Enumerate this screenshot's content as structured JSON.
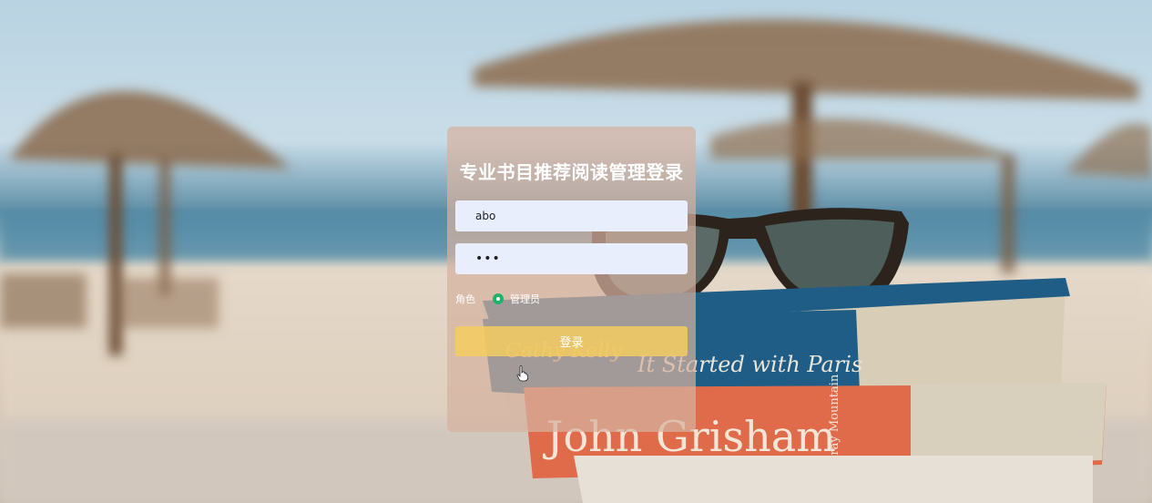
{
  "login": {
    "title": "专业书目推荐阅读管理登录",
    "username_value": "abo",
    "password_value": "•••",
    "role_label": "角色",
    "role_options": [
      {
        "label": "管理员",
        "selected": true
      }
    ],
    "submit_label": "登录"
  },
  "background": {
    "book_titles": [
      "John Grisham",
      "It Started with Paris",
      "Cathy Kelly",
      "Gray Mountain"
    ]
  },
  "colors": {
    "card_bg": "#d6b2a0",
    "input_bg": "#e8eefc",
    "button_bg": "#f5cd60",
    "radio_selected": "#1fb26b"
  }
}
